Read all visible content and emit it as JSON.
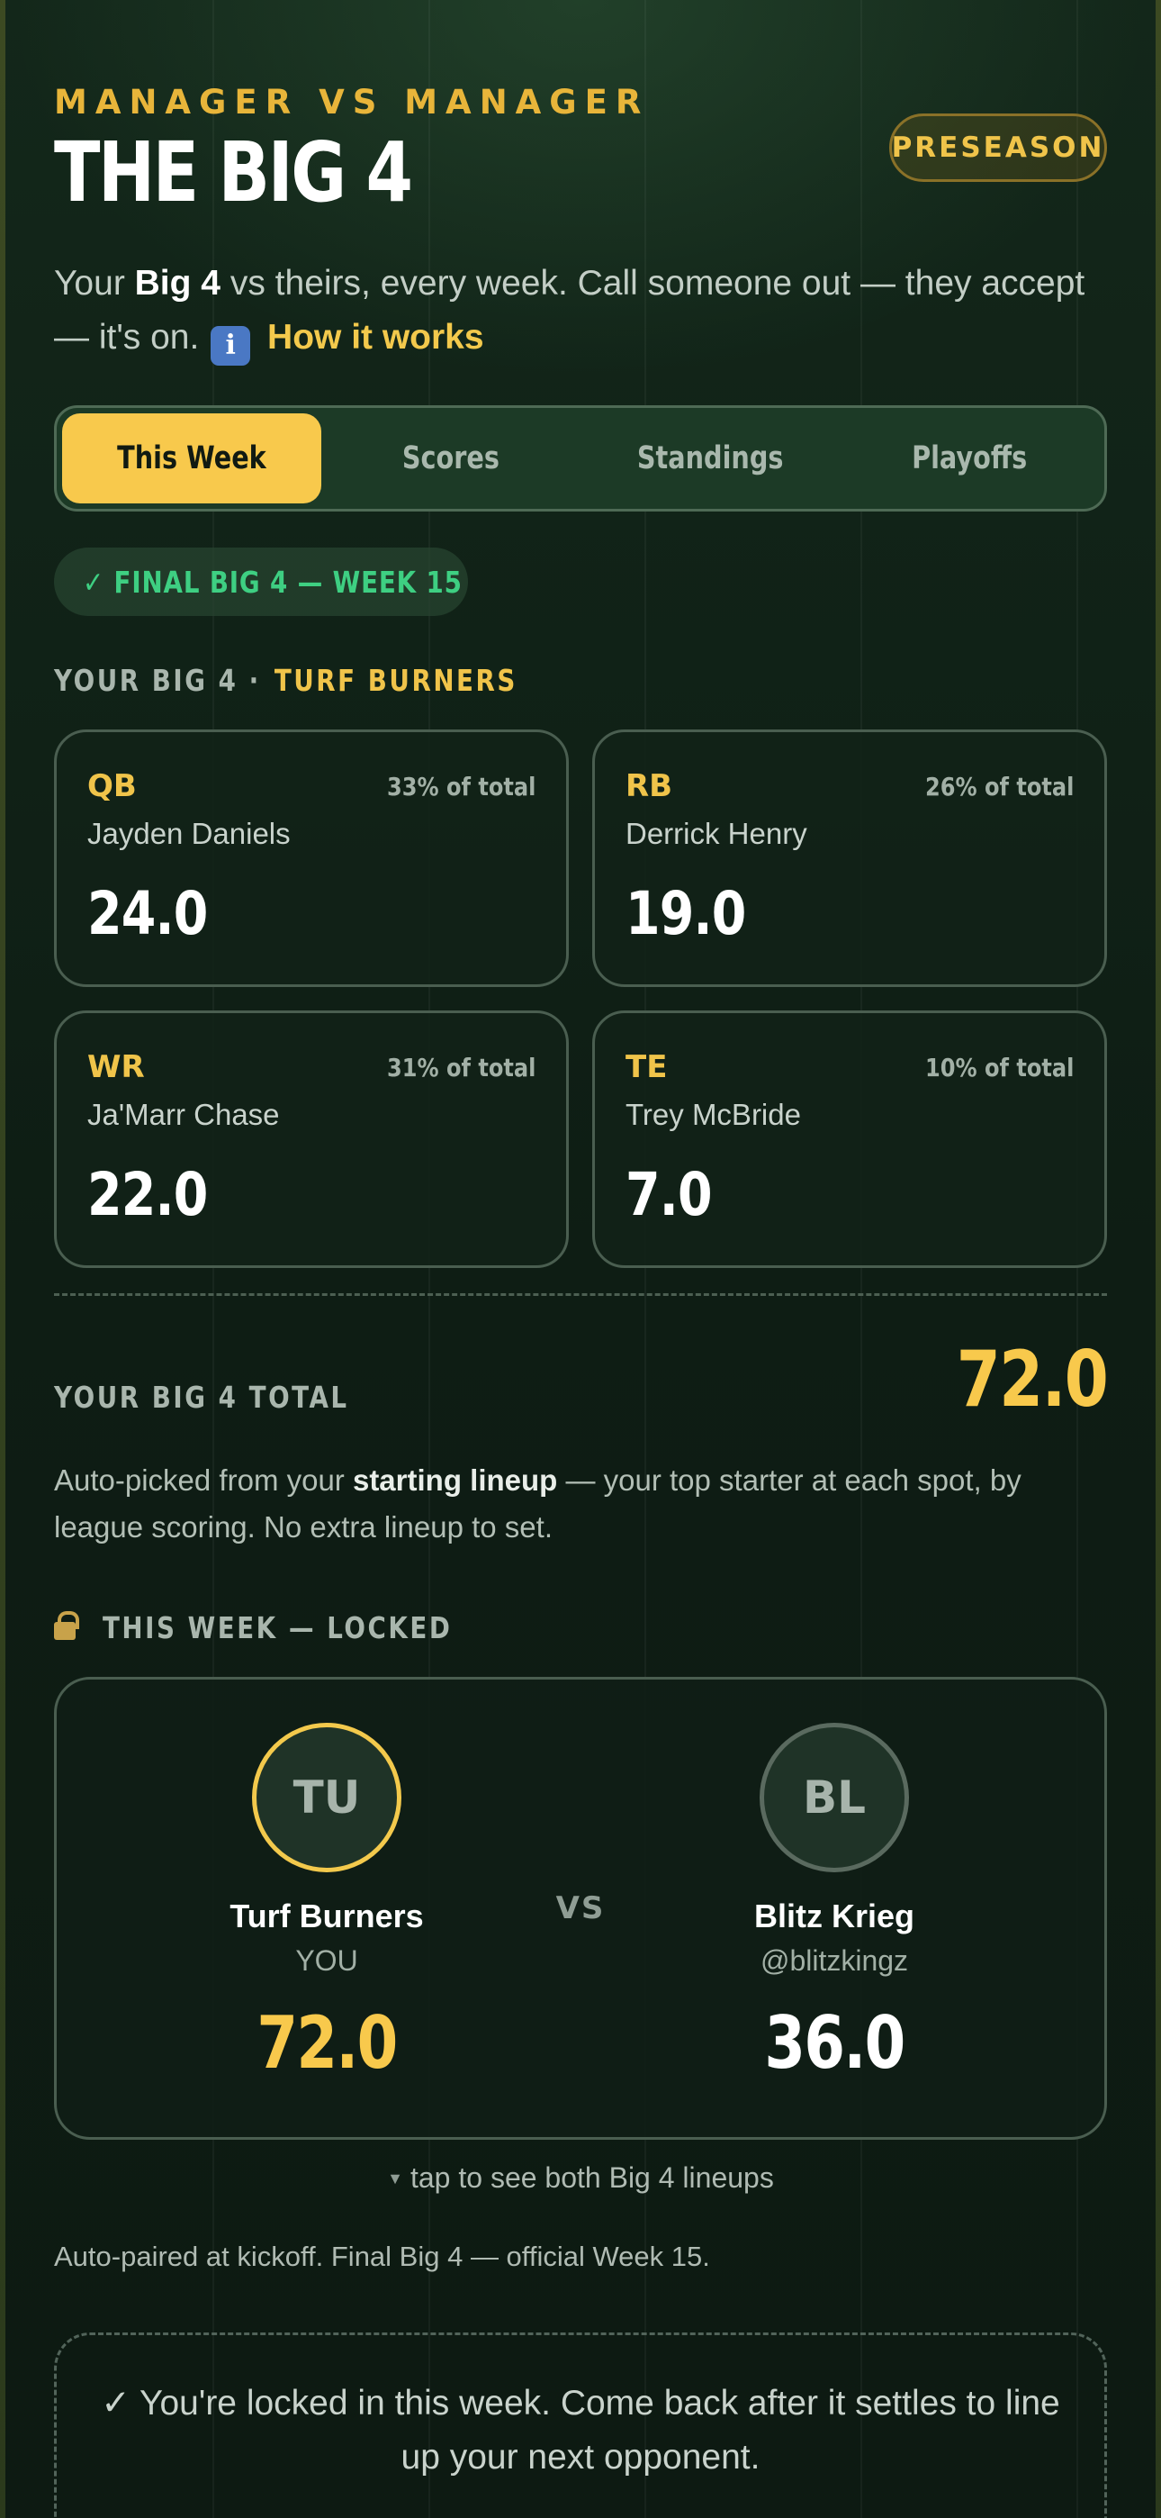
{
  "header": {
    "eyebrow": "MANAGER VS MANAGER",
    "title": "THE BIG 4",
    "badge": "PRESEASON"
  },
  "intro": {
    "prefix": "Your ",
    "bold": "Big 4",
    "rest": " vs theirs, every week. Call someone out — they accept — it's on.",
    "info_icon": "info-icon",
    "link": "How it works"
  },
  "tabs": [
    {
      "label": "This Week",
      "active": true
    },
    {
      "label": "Scores",
      "active": false
    },
    {
      "label": "Standings",
      "active": false
    },
    {
      "label": "Playoffs",
      "active": false
    }
  ],
  "status_pill": "✓ FINAL BIG 4 — WEEK 15",
  "your_big4": {
    "heading": "YOUR BIG 4 ·",
    "team": "TURF BURNERS",
    "players": [
      {
        "pos": "QB",
        "share": "33% of total",
        "name": "Jayden Daniels",
        "points": "24.0"
      },
      {
        "pos": "RB",
        "share": "26% of total",
        "name": "Derrick Henry",
        "points": "19.0"
      },
      {
        "pos": "WR",
        "share": "31% of total",
        "name": "Ja'Marr Chase",
        "points": "22.0"
      },
      {
        "pos": "TE",
        "share": "10% of total",
        "name": "Trey McBride",
        "points": "7.0"
      }
    ],
    "total_label": "YOUR BIG 4 TOTAL",
    "total_value": "72.0",
    "note_prefix": "Auto-picked from your ",
    "note_bold": "starting lineup",
    "note_rest": " — your top starter at each spot, by league scoring. No extra lineup to set."
  },
  "matchup": {
    "heading": "THIS WEEK — LOCKED",
    "lock_icon": "lock-icon",
    "vs": "VS",
    "you": {
      "initials": "TU",
      "name": "Turf Burners",
      "sub": "YOU",
      "score": "72.0"
    },
    "opponent": {
      "initials": "BL",
      "name": "Blitz Krieg",
      "sub": "@blitzkingz",
      "score": "36.0"
    },
    "tap_hint": "tap to see both Big 4 lineups",
    "paired_note": "Auto-paired at kickoff. Final Big 4 — official Week 15.",
    "locked_message": "✓ You're locked in this week. Come back after it settles to line up your next opponent."
  },
  "colors": {
    "accent": "#f8c94c",
    "final_green": "#3ecf82",
    "background": "#0f1c14"
  }
}
